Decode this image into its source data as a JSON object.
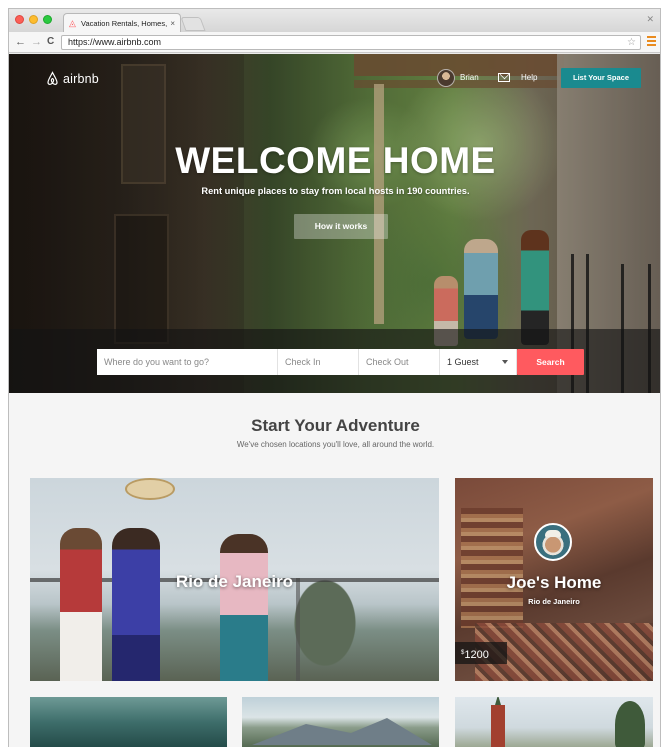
{
  "browser": {
    "tab_title": "Vacation Rentals, Homes, ...",
    "tab_close": "×",
    "url": "https://www.airbnb.com",
    "back": "←",
    "forward": "→",
    "reload": "C",
    "star": "☆"
  },
  "header": {
    "logo_text": "airbnb",
    "user_name": "Brian",
    "help_label": "Help",
    "list_space_label": "List Your Space"
  },
  "hero": {
    "title": "WELCOME HOME",
    "subtitle": "Rent unique places to stay from local hosts in 190 countries.",
    "how_it_works": "How it works"
  },
  "search": {
    "where_placeholder": "Where do you want to go?",
    "check_in": "Check In",
    "check_out": "Check Out",
    "guests": "1 Guest",
    "button": "Search"
  },
  "section": {
    "title": "Start Your Adventure",
    "subtitle": "We've chosen locations you'll love, all around the world."
  },
  "cards": {
    "rio": {
      "label": "Rio de Janeiro"
    },
    "joe": {
      "label": "Joe's Home",
      "location": "Rio de Janeiro",
      "currency": "$",
      "price": "1200"
    }
  },
  "colors": {
    "brand": "#ff5a5f",
    "teal": "#1a8a8f"
  }
}
